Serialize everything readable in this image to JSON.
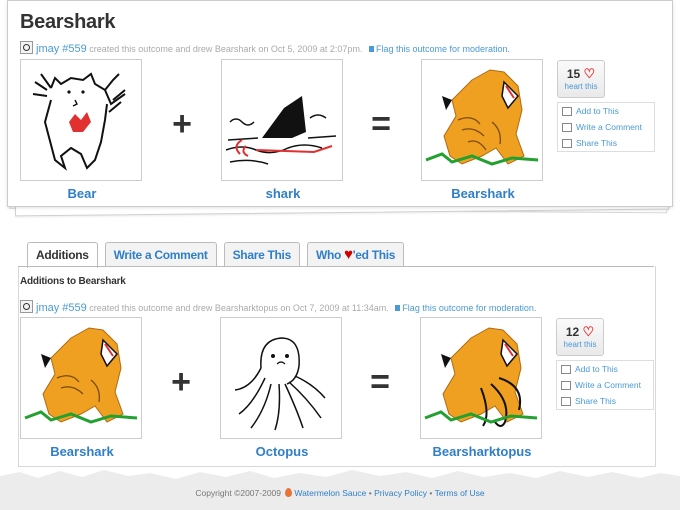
{
  "outcome": {
    "title": "Bearshark",
    "user": "jmay #559",
    "meta_text": "created this outcome and drew Bearshark on Oct 5, 2009 at 2:07pm.",
    "flag_text": "Flag this outcome for moderation.",
    "tiles": {
      "left": "Bear",
      "middle": "shark",
      "result": "Bearshark"
    },
    "plus": "+",
    "equals": "=",
    "heart_count": "15",
    "heart_link": "heart this",
    "actions": [
      "Add to This",
      "Write a Comment",
      "Share This"
    ]
  },
  "tabs": [
    {
      "label": "Additions"
    },
    {
      "label": "Write a Comment"
    },
    {
      "label": "Share This"
    },
    {
      "label_before": "Who",
      "label_after": "'ed This"
    }
  ],
  "additions": {
    "title": "Additions to Bearshark",
    "user": "jmay #559",
    "meta_text": "created this outcome and drew Bearsharktopus on Oct 7, 2009 at 11:34am.",
    "flag_text": "Flag this outcome for moderation.",
    "tiles": {
      "left": "Bearshark",
      "middle": "Octopus",
      "result": "Bearsharktopus"
    },
    "plus": "+",
    "equals": "=",
    "heart_count": "12",
    "heart_link": "heart this",
    "actions": [
      "Add to This",
      "Write a Comment",
      "Share This"
    ]
  },
  "footer": {
    "copyright": "Copyright ©2007-2009",
    "brand": "Watermelon Sauce",
    "sep": "•",
    "privacy": "Privacy Policy",
    "terms": "Terms of Use"
  },
  "colors": {
    "link": "#2f7fc8",
    "heart": "#e03030",
    "orange": "#f0a020"
  }
}
